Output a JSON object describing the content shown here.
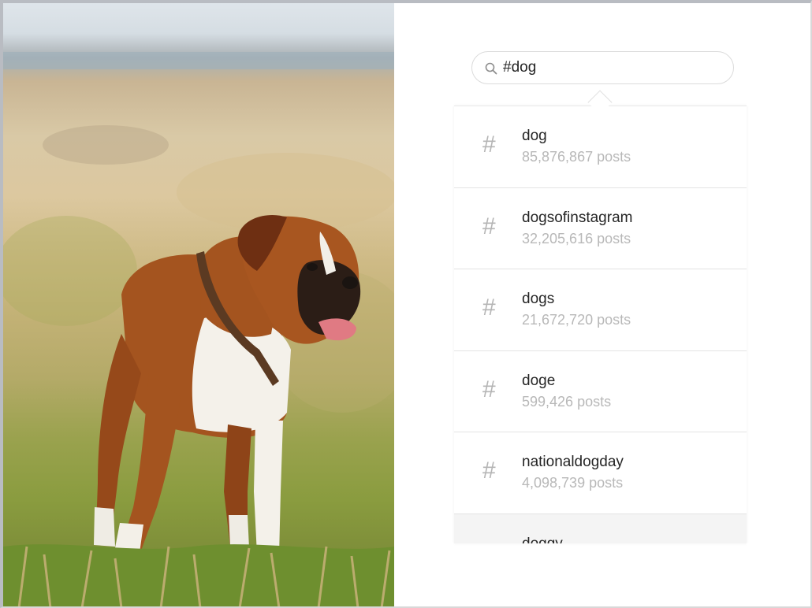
{
  "search": {
    "value": "#dog",
    "icon": "search-icon"
  },
  "results": [
    {
      "name": "dog",
      "count": "85,876,867 posts"
    },
    {
      "name": "dogsofinstagram",
      "count": "32,205,616 posts"
    },
    {
      "name": "dogs",
      "count": "21,672,720 posts"
    },
    {
      "name": "doge",
      "count": "599,426 posts"
    },
    {
      "name": "nationaldogday",
      "count": "4,098,739 posts"
    },
    {
      "name": "doggy",
      "count": ""
    }
  ],
  "result_icon": "hashtag-icon",
  "hash_glyph": "#",
  "colors": {
    "text_primary": "#262626",
    "text_secondary": "#b8b8b8",
    "border": "#dbdbdb",
    "highlight_row": "#f4f4f4"
  }
}
